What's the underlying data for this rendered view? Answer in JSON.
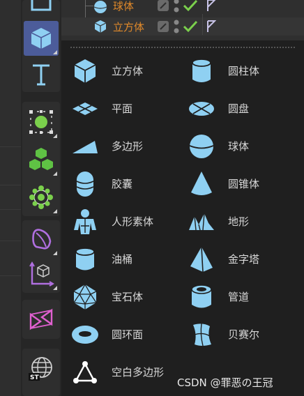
{
  "object_manager": {
    "rows": [
      {
        "name": "球体"
      },
      {
        "name": "立方体"
      }
    ]
  },
  "menu": {
    "items": [
      {
        "label": "立方体",
        "icon": "cube-icon"
      },
      {
        "label": "圆柱体",
        "icon": "cylinder-icon"
      },
      {
        "label": "平面",
        "icon": "plane-icon"
      },
      {
        "label": "圆盘",
        "icon": "disc-icon"
      },
      {
        "label": "多边形",
        "icon": "polygon-icon"
      },
      {
        "label": "球体",
        "icon": "sphere-icon"
      },
      {
        "label": "胶囊",
        "icon": "capsule-icon"
      },
      {
        "label": "圆锥体",
        "icon": "cone-icon"
      },
      {
        "label": "人形素体",
        "icon": "figure-icon"
      },
      {
        "label": "地形",
        "icon": "landscape-icon"
      },
      {
        "label": "油桶",
        "icon": "oil-tank-icon"
      },
      {
        "label": "金字塔",
        "icon": "pyramid-icon"
      },
      {
        "label": "宝石体",
        "icon": "platonic-icon"
      },
      {
        "label": "管道",
        "icon": "tube-icon"
      },
      {
        "label": "圆环面",
        "icon": "torus-icon"
      },
      {
        "label": "贝赛尔",
        "icon": "bezier-icon"
      },
      {
        "label": "空白多边形",
        "icon": "empty-polygon-icon"
      }
    ]
  },
  "toolbar": {
    "buttons": [
      "square-icon",
      "cube-icon",
      "text-icon",
      "points-icon",
      "cloner-icon",
      "gear-points-icon",
      "deformer-icon",
      "axis-cube-icon",
      "frame-icon",
      "globe-st-icon"
    ]
  },
  "watermark": "CSDN @罪恶の王冠",
  "colors": {
    "icon_blue": "#8fd0f2",
    "accent_orange": "#e0892a",
    "check_green": "#7bd04c",
    "active_blue": "#4c5c9a"
  }
}
